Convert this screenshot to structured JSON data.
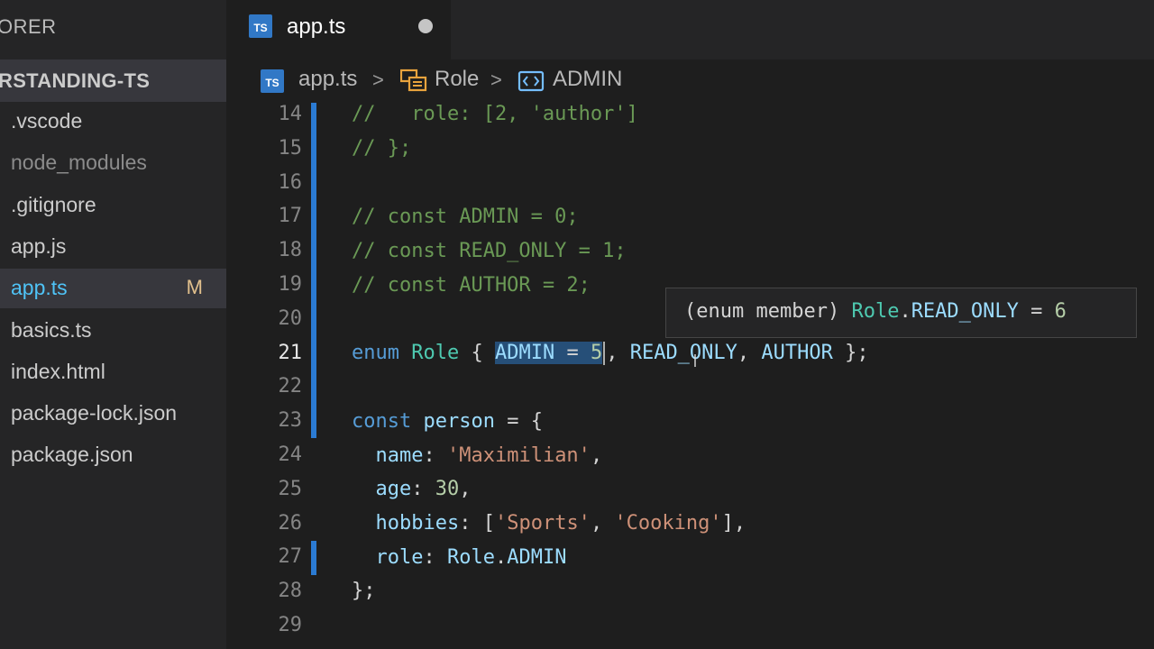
{
  "explorer": {
    "title": "ORER",
    "folder": "RSTANDING-TS",
    "files": [
      {
        "name": ".vscode",
        "dim": false,
        "active": false,
        "badge": ""
      },
      {
        "name": "node_modules",
        "dim": true,
        "active": false,
        "badge": ""
      },
      {
        "name": ".gitignore",
        "dim": false,
        "active": false,
        "badge": ""
      },
      {
        "name": "app.js",
        "dim": false,
        "active": false,
        "badge": ""
      },
      {
        "name": "app.ts",
        "dim": false,
        "active": true,
        "badge": "M"
      },
      {
        "name": "basics.ts",
        "dim": false,
        "active": false,
        "badge": ""
      },
      {
        "name": "index.html",
        "dim": false,
        "active": false,
        "badge": ""
      },
      {
        "name": "package-lock.json",
        "dim": false,
        "active": false,
        "badge": ""
      },
      {
        "name": "package.json",
        "dim": false,
        "active": false,
        "badge": ""
      }
    ]
  },
  "tab": {
    "icon": "TS",
    "label": "app.ts",
    "dirty": true
  },
  "breadcrumb": {
    "file": "app.ts",
    "separator": ">",
    "symbol1": "Role",
    "symbol2": "ADMIN",
    "file_icon": "TS"
  },
  "editor": {
    "line_numbers": [
      "14",
      "15",
      "16",
      "17",
      "18",
      "19",
      "20",
      "21",
      "22",
      "23",
      "24",
      "25",
      "26",
      "27",
      "28",
      "29"
    ],
    "current_line": "21",
    "lines": {
      "l14": {
        "comment": "//   role: [2, 'author']"
      },
      "l15": {
        "comment": "// };"
      },
      "l17": {
        "comment": "// const ADMIN = 0;"
      },
      "l18": {
        "comment": "// const READ_ONLY = 1;"
      },
      "l19": {
        "comment": "// const AUTHOR = 2;"
      },
      "l21": {
        "kw": "enum",
        "type": "Role",
        "open": "{",
        "sel_name": "ADMIN",
        "sel_eq": "=",
        "sel_val": "5",
        "comma1": ",",
        "member2": "READ_ONLY",
        "comma2": ",",
        "member3": "AUTHOR",
        "close": "};"
      },
      "l23": {
        "kw": "const",
        "var": "person",
        "eq": "=",
        "open": "{"
      },
      "l24": {
        "key": "name",
        "colon": ":",
        "str": "'Maximilian'",
        "comma": ","
      },
      "l25": {
        "key": "age",
        "colon": ":",
        "num": "30",
        "comma": ","
      },
      "l26": {
        "key": "hobbies",
        "colon": ":",
        "open": "[",
        "str1": "'Sports'",
        "sep": ",",
        "str2": "'Cooking'",
        "close": "],"
      },
      "l27": {
        "key": "role",
        "colon": ":",
        "obj": "Role",
        "dot": ".",
        "member": "ADMIN"
      },
      "l28": {
        "close": "};"
      }
    }
  },
  "hover": {
    "open": "(",
    "kind": "enum member",
    "close": ")",
    "type": "Role",
    "dot": ".",
    "member": "READ_ONLY",
    "eq": "=",
    "value": "6"
  },
  "colors": {
    "accent": "#2b7bd3",
    "ts_icon": "#3178c6",
    "modified_badge": "#e2c08d",
    "modified_file": "#4fc3f7"
  }
}
